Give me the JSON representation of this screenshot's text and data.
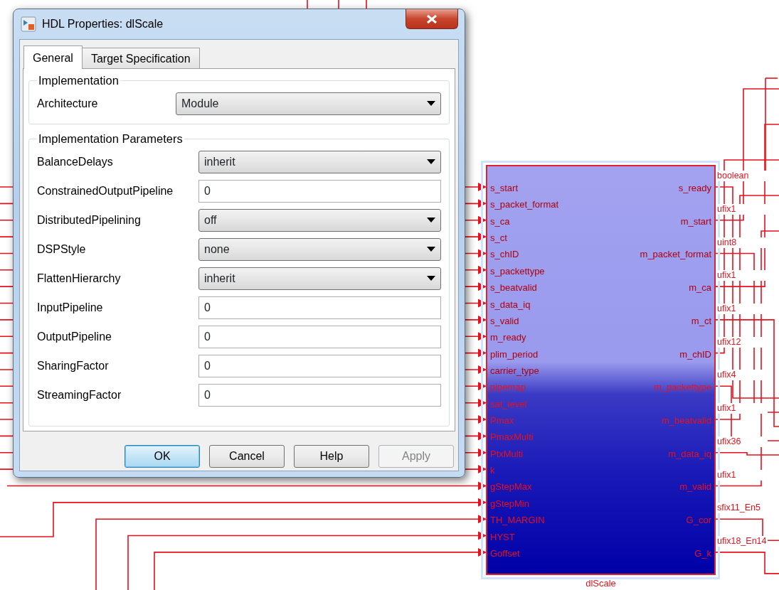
{
  "dialog": {
    "title": "HDL Properties: dlScale",
    "tabs": [
      {
        "label": "General",
        "selected": true
      },
      {
        "label": "Target Specification",
        "selected": false
      }
    ],
    "sections": [
      {
        "title": "Implementation",
        "fields": [
          {
            "label": "Architecture",
            "kind": "select",
            "value": "Module"
          }
        ]
      },
      {
        "title": "Implementation Parameters",
        "fields": [
          {
            "label": "BalanceDelays",
            "kind": "select",
            "value": "inherit"
          },
          {
            "label": "ConstrainedOutputPipeline",
            "kind": "text",
            "value": "0"
          },
          {
            "label": "DistributedPipelining",
            "kind": "select",
            "value": "off"
          },
          {
            "label": "DSPStyle",
            "kind": "select",
            "value": "none"
          },
          {
            "label": "FlattenHierarchy",
            "kind": "select",
            "value": "inherit"
          },
          {
            "label": "InputPipeline",
            "kind": "text",
            "value": "0"
          },
          {
            "label": "OutputPipeline",
            "kind": "text",
            "value": "0"
          },
          {
            "label": "SharingFactor",
            "kind": "text",
            "value": "0"
          },
          {
            "label": "StreamingFactor",
            "kind": "text",
            "value": "0"
          }
        ]
      }
    ],
    "buttons": [
      {
        "label": "OK",
        "default": true,
        "disabled": false
      },
      {
        "label": "Cancel",
        "default": false,
        "disabled": false
      },
      {
        "label": "Help",
        "default": false,
        "disabled": false
      },
      {
        "label": "Apply",
        "default": false,
        "disabled": true
      }
    ]
  },
  "block": {
    "name": "dlScale",
    "inputs": [
      "s_start",
      "s_packet_format",
      "s_ca",
      "s_ct",
      "s_chID",
      "s_packettype",
      "s_beatvalid",
      "s_data_iq",
      "s_valid",
      "m_ready",
      "plim_period",
      "carrier_type",
      "pipemap",
      "sat_level",
      "Pmax",
      "PmaxMulti",
      "PtxMulti",
      "k",
      "gStepMax",
      "gStepMin",
      "TH_MARGIN",
      "HYST",
      "Goffset"
    ],
    "outputs": [
      {
        "name": "s_ready",
        "type": "boolean"
      },
      {
        "name": "m_start",
        "type": "ufix1"
      },
      {
        "name": "m_packet_format",
        "type": "uint8"
      },
      {
        "name": "m_ca",
        "type": "ufix1"
      },
      {
        "name": "m_ct",
        "type": "ufix1"
      },
      {
        "name": "m_chID",
        "type": "ufix12"
      },
      {
        "name": "m_packettype",
        "type": "ufix4"
      },
      {
        "name": "m_beatvalid",
        "type": "ufix1"
      },
      {
        "name": "m_data_iq",
        "type": "ufix36"
      },
      {
        "name": "m_valid",
        "type": "ufix1"
      },
      {
        "name": "G_cor",
        "type": "sfix11_En5"
      },
      {
        "name": "G_k",
        "type": "ufix18_En14"
      }
    ]
  }
}
